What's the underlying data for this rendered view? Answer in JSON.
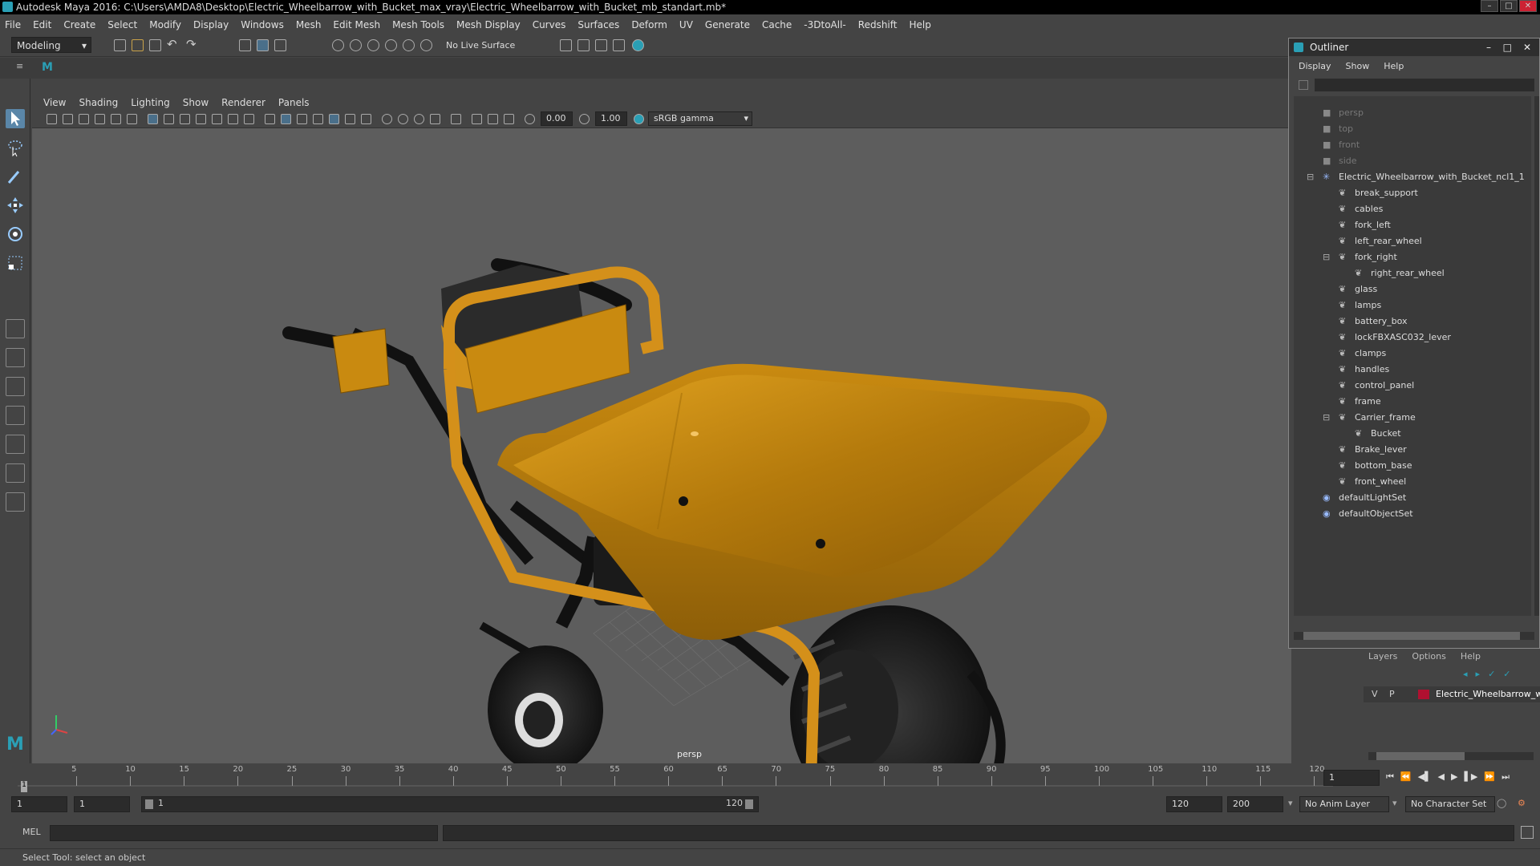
{
  "window": {
    "title": "Autodesk Maya 2016: C:\\Users\\AMDA8\\Desktop\\Electric_Wheelbarrow_with_Bucket_max_vray\\Electric_Wheelbarrow_with_Bucket_mb_standart.mb*"
  },
  "menubar": [
    "File",
    "Edit",
    "Create",
    "Select",
    "Modify",
    "Display",
    "Windows",
    "Mesh",
    "Edit Mesh",
    "Mesh Tools",
    "Mesh Display",
    "Curves",
    "Surfaces",
    "Deform",
    "UV",
    "Generate",
    "Cache",
    "-3DtoAll-",
    "Redshift",
    "Help"
  ],
  "statusline": {
    "mode": "Modeling",
    "live_surface": "No Live Surface"
  },
  "panel": {
    "menus": [
      "View",
      "Shading",
      "Lighting",
      "Show",
      "Renderer",
      "Panels"
    ],
    "exposure": "0.00",
    "gamma": "1.00",
    "colorspace": "sRGB gamma",
    "camera_label": "persp"
  },
  "outliner": {
    "title": "Outliner",
    "menus": [
      "Display",
      "Show",
      "Help"
    ],
    "items": [
      {
        "name": "persp",
        "dim": true
      },
      {
        "name": "top",
        "dim": true
      },
      {
        "name": "front",
        "dim": true
      },
      {
        "name": "side",
        "dim": true
      },
      {
        "name": "Electric_Wheelbarrow_with_Bucket_ncl1_1"
      },
      {
        "name": "break_support"
      },
      {
        "name": "cables"
      },
      {
        "name": "fork_left"
      },
      {
        "name": "left_rear_wheel"
      },
      {
        "name": "fork_right"
      },
      {
        "name": "right_rear_wheel"
      },
      {
        "name": "glass"
      },
      {
        "name": "lamps"
      },
      {
        "name": "battery_box"
      },
      {
        "name": "lockFBXASC032_lever"
      },
      {
        "name": "clamps"
      },
      {
        "name": "handles"
      },
      {
        "name": "control_panel"
      },
      {
        "name": "frame"
      },
      {
        "name": "Carrier_frame"
      },
      {
        "name": "Bucket"
      },
      {
        "name": "Brake_lever"
      },
      {
        "name": "bottom_base"
      },
      {
        "name": "front_wheel"
      },
      {
        "name": "defaultLightSet"
      },
      {
        "name": "defaultObjectSet"
      }
    ]
  },
  "layers": {
    "menus": [
      "Layers",
      "Options",
      "Help"
    ],
    "row": {
      "v": "V",
      "p": "P",
      "name": "Electric_Wheelbarrow_w",
      "color": "#b01030"
    }
  },
  "timeline": {
    "ticks": [
      "5",
      "10",
      "15",
      "20",
      "25",
      "30",
      "35",
      "40",
      "45",
      "50",
      "55",
      "60",
      "65",
      "70",
      "75",
      "80",
      "85",
      "90",
      "95",
      "100",
      "105",
      "110",
      "115",
      "120"
    ],
    "start_marker": "1",
    "current_frame": "1"
  },
  "range": {
    "start": "1",
    "playback_start": "1",
    "slider_start": "1",
    "slider_end": "120",
    "playback_end": "120",
    "end": "200",
    "anim_layer": "No Anim Layer",
    "char_set": "No Character Set"
  },
  "mel": {
    "label": "MEL"
  },
  "status": {
    "text": "Select Tool: select an object"
  },
  "colors": {
    "bucket": "#c98a10",
    "frame": "#d4901a",
    "tire": "#1d1d1d"
  }
}
